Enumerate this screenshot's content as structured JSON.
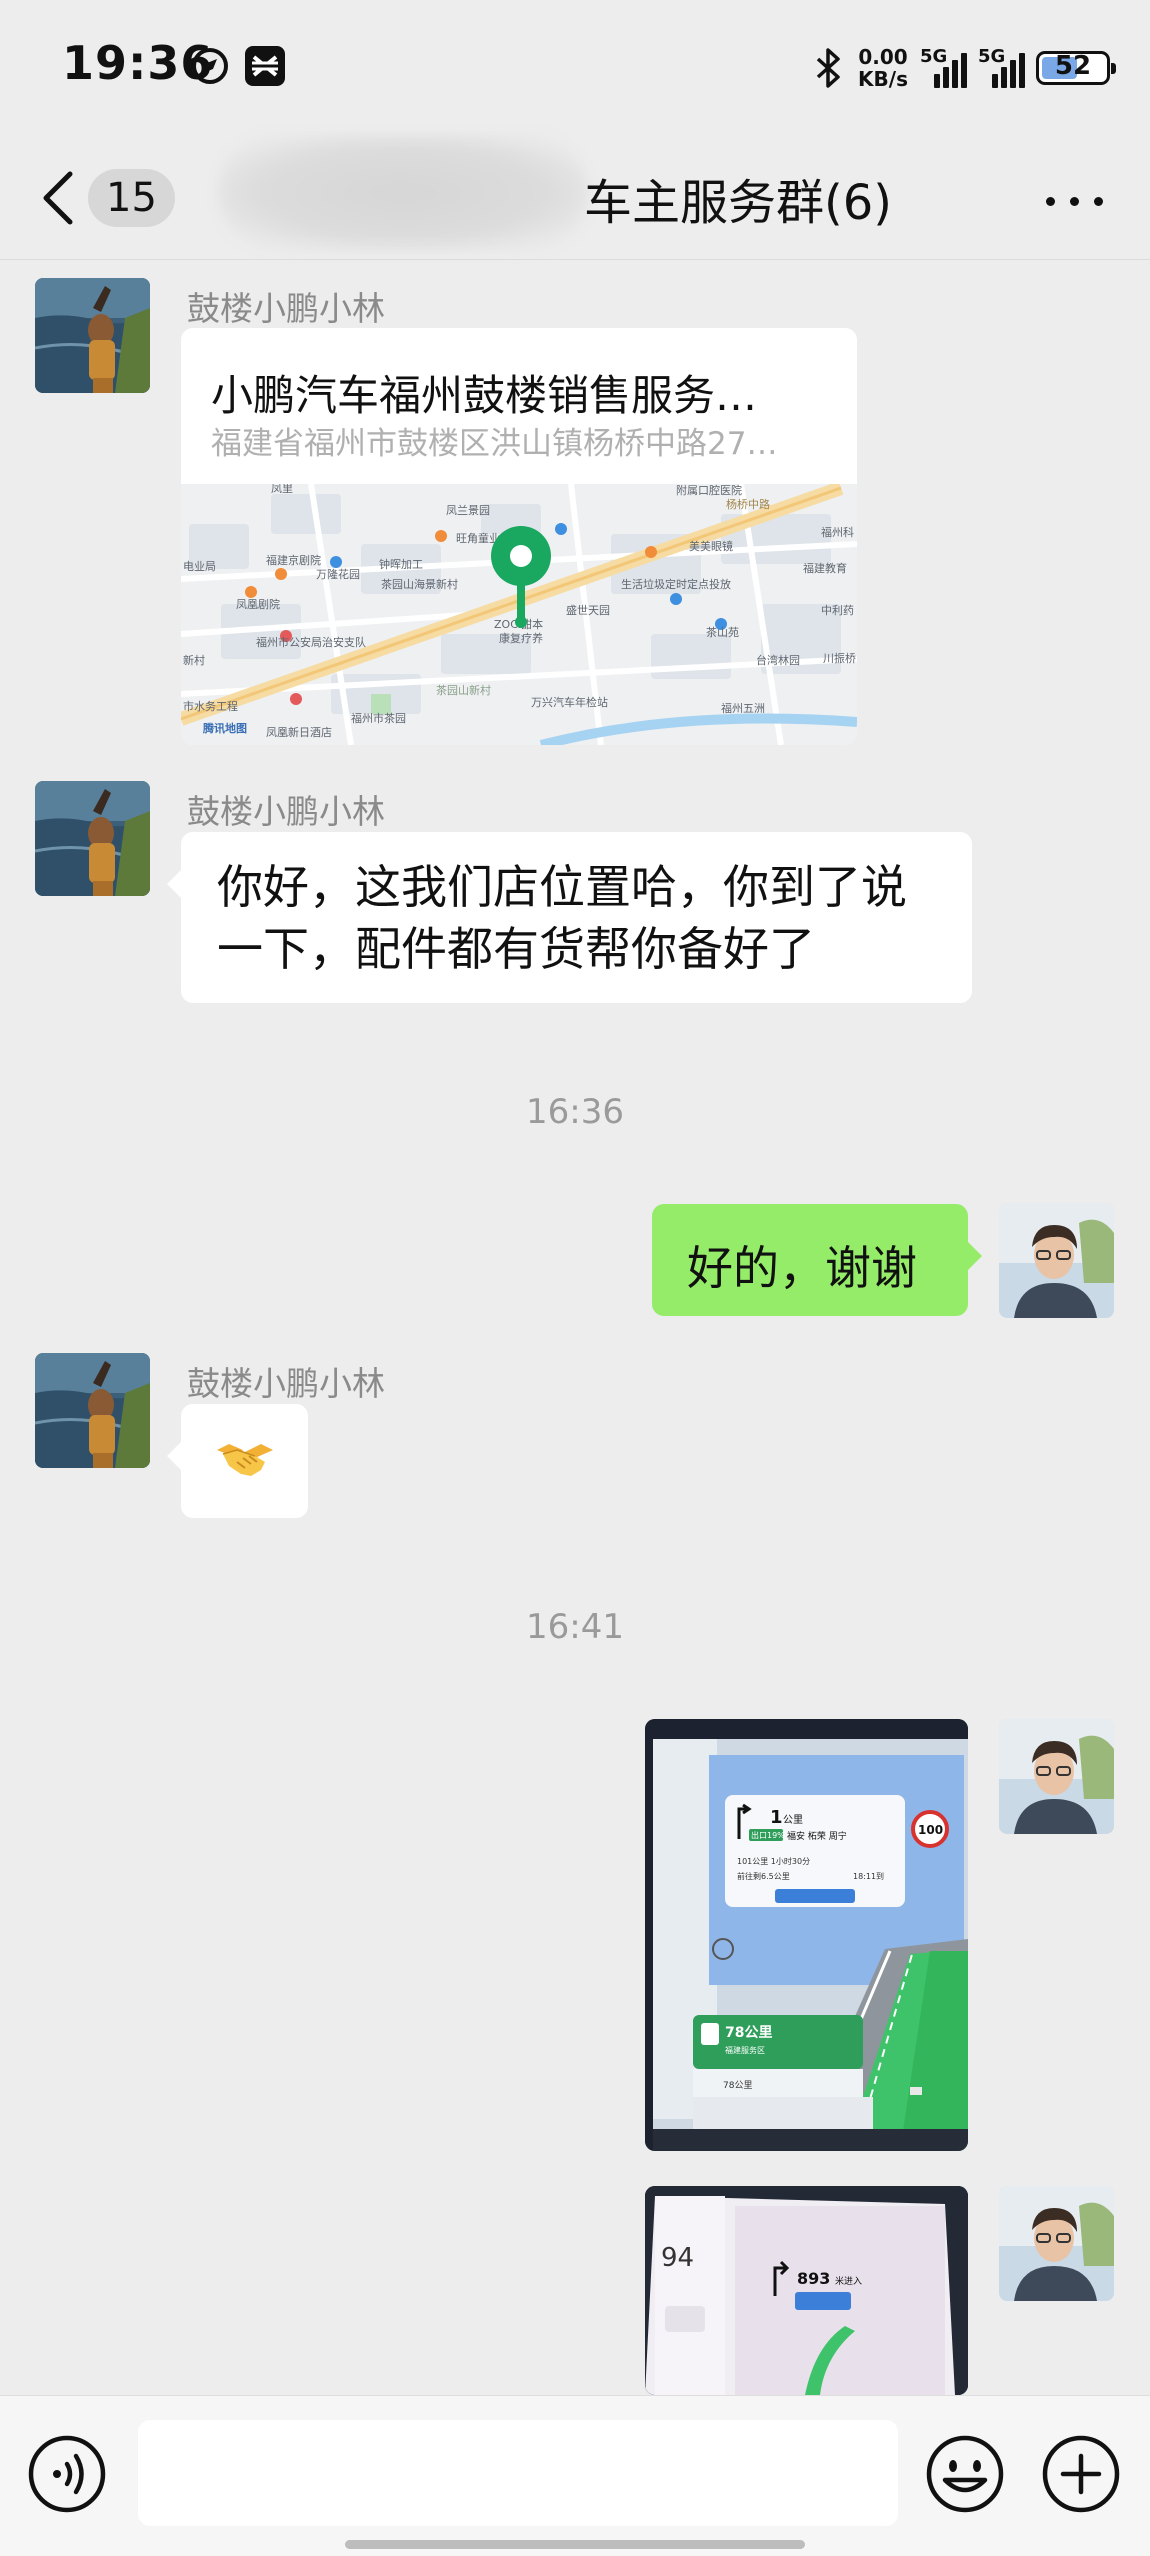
{
  "status_bar": {
    "time": "19:36",
    "net_speed_value": "0.00",
    "net_speed_unit": "KB/s",
    "signal_1": "5G",
    "signal_2": "5G",
    "battery": "52",
    "icons": [
      "compass-icon",
      "capcut-icon",
      "bluetooth-icon",
      "signal-icon",
      "battery-icon"
    ]
  },
  "nav": {
    "unread_count": "15",
    "title": "车主服务群(6)",
    "icons": [
      "back-chevron-icon",
      "more-icon"
    ]
  },
  "messages": [
    {
      "type": "location",
      "sender": "鼓楼小鹏小林",
      "place_name": "小鹏汽车福州鼓楼销售服务…",
      "address": "福建省福州市鼓楼区洪山镇杨桥中路27…",
      "map_labels": {
        "l01": "凤里",
        "l02": "凤兰景园",
        "l03": "附属口腔医院",
        "l04": "杨桥中路",
        "l05": "福州科",
        "l06": "福建京剧院",
        "l07": "旺角童业",
        "l08": "美美眼镜",
        "l09": "电业局",
        "l10": "万隆花园",
        "l11": "钟晖加工",
        "l12": "茶园山海景新村",
        "l13": "凤凰剧院",
        "l14": "ZOCI甜本",
        "l15": "康复疗养",
        "l16": "生活垃圾定时定点投放",
        "l17": "盛世天园",
        "l18": "福州市公安局治安支队",
        "l19": "茶山苑",
        "l20": "台湾林园",
        "l21": "茶园山新村",
        "l22": "万兴汽车年检站",
        "l23": "市水务工程",
        "l24": "福州市茶园",
        "l25": "福州五洲",
        "l26": "凤凰新日酒店",
        "l27": "腾讯地图",
        "l28": "新村",
        "l29": "川振桥",
        "l30": "福建教育",
        "l31": "中利药"
      }
    },
    {
      "type": "text",
      "direction": "in",
      "sender": "鼓楼小鹏小林",
      "text_line_1": "你好，这我们店位置哈，你到了说",
      "text_line_2": "一下，配件都有货帮你备好了"
    },
    {
      "type": "time",
      "text": "16:36"
    },
    {
      "type": "text",
      "direction": "out",
      "text": "好的，谢谢"
    },
    {
      "type": "sticker",
      "direction": "in",
      "sender": "鼓楼小鹏小林",
      "emoji_name": "handshake-emoji"
    },
    {
      "type": "time",
      "text": "16:41"
    },
    {
      "type": "image",
      "direction": "out",
      "nav_screen": {
        "distance": "1",
        "distance_unit": "公里",
        "exit_tag": "出口19%",
        "direction_text": "福安 柘荣 周宁",
        "remaining": "101公里 1小时30分",
        "eta": "18:11到",
        "next_hint": "前往剩6.5公里",
        "speed_limit": "100",
        "service_distance": "78公里",
        "service_name": "福建服务区",
        "service_distance_2": "78公里"
      }
    },
    {
      "type": "image",
      "direction": "out",
      "nav_screen": {
        "speed": "94",
        "distance": "893",
        "distance_unit": "米进入"
      }
    }
  ],
  "input_bar": {
    "draft": "",
    "icons": [
      "voice-icon",
      "emoji-icon",
      "plus-icon"
    ]
  },
  "colors": {
    "background": "#ededed",
    "bubble_out": "#95ec69",
    "bubble_in": "#ffffff",
    "map_pin": "#1aa860"
  }
}
